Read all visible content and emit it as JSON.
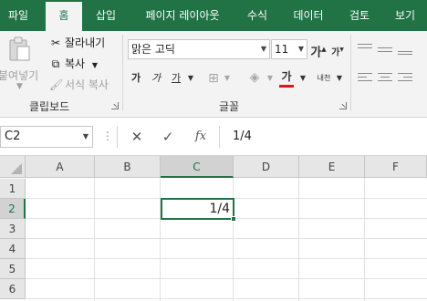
{
  "tabs": [
    "파일",
    "홈",
    "삽입",
    "페이지 레이아웃",
    "수식",
    "데이터",
    "검토",
    "보기"
  ],
  "active_tab": "홈",
  "ribbon": {
    "clipboard": {
      "paste_label": "붙여넣기",
      "cut_label": "잘라내기",
      "copy_label": "복사",
      "format_painter_label": "서식 복사",
      "group_label": "클립보드"
    },
    "font": {
      "font_name": "맑은 고딕",
      "font_size": "11",
      "grow_label": "가",
      "shrink_label": "가",
      "bold_label": "가",
      "italic_label": "가",
      "underline_label": "가",
      "font_color_label": "가",
      "phonetic_label": "내천",
      "group_label": "글꼴",
      "font_color_hex": "#e81123"
    }
  },
  "formula_bar": {
    "name_box": "C2",
    "fx_label": "fx",
    "content": "1/4"
  },
  "grid": {
    "columns": [
      "A",
      "B",
      "C",
      "D",
      "E",
      "F"
    ],
    "rows": [
      "1",
      "2",
      "3",
      "4",
      "5",
      "6"
    ],
    "selected_column": "C",
    "selected_row": "2",
    "active_cell_value": "1/4"
  },
  "colors": {
    "accent": "#217346",
    "ribbon_bg": "#f3f3f3",
    "header_bg": "#e6e6e6"
  }
}
